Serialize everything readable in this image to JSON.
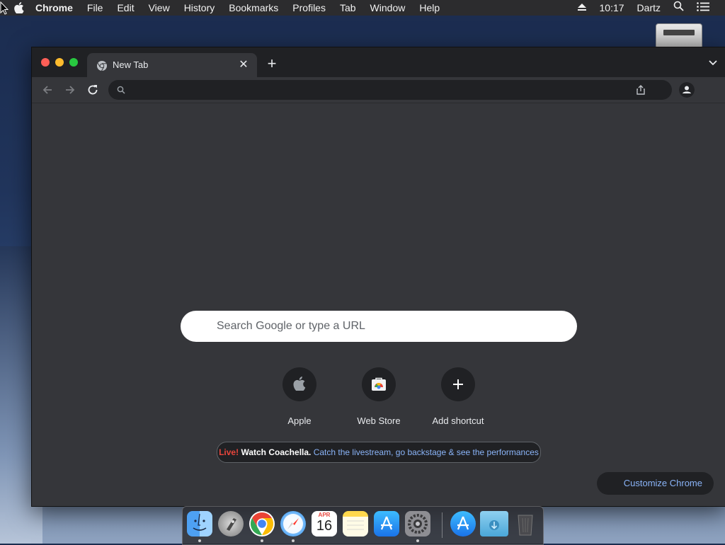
{
  "menubar": {
    "app_name": "Chrome",
    "items": [
      "File",
      "Edit",
      "View",
      "History",
      "Bookmarks",
      "Profiles",
      "Tab",
      "Window",
      "Help"
    ],
    "clock": "10:17",
    "user": "Dartz"
  },
  "browser": {
    "tab_title": "New Tab",
    "omnibox_value": ""
  },
  "ntp": {
    "search_placeholder": "Search Google or type a URL",
    "shortcuts": [
      {
        "label": "Apple",
        "icon": "apple-icon"
      },
      {
        "label": "Web Store",
        "icon": "web-store-icon"
      },
      {
        "label": "Add shortcut",
        "icon": "plus-icon"
      }
    ],
    "promo": {
      "live": "Live!",
      "watch": "Watch Coachella.",
      "link": "Catch the livestream, go backstage & see the performances"
    },
    "customize_label": "Customize Chrome"
  },
  "dock": {
    "apps": [
      "finder-icon",
      "launchpad-icon",
      "chrome-icon",
      "safari-icon",
      "calendar-icon",
      "notes-icon",
      "app-store-icon",
      "system-preferences-icon",
      "app-store-folder-icon",
      "downloads-folder-icon",
      "trash-icon"
    ],
    "calendar": {
      "month": "APR",
      "day": "16"
    }
  },
  "colors": {
    "accent": "#8ab4f8",
    "live_red": "#e8453c",
    "window_bg": "#35363a",
    "tabstrip_bg": "#202124"
  }
}
